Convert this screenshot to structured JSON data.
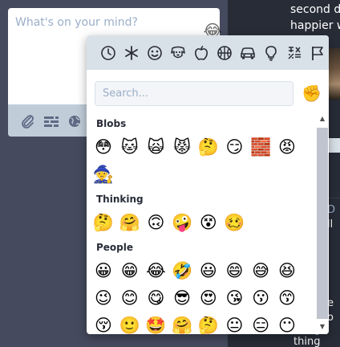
{
  "compose": {
    "placeholder": "What's on your mind?",
    "emoji_trigger": "😂",
    "tools": [
      "paperclip-icon",
      "poll-icon",
      "globe-icon"
    ]
  },
  "background": {
    "toot_text": [
      "second d",
      "happier w"
    ],
    "fragments": [
      "i",
      "t",
      "l",
      "ll",
      "D",
      "e",
      "o",
      "thing"
    ]
  },
  "picker": {
    "categories": [
      {
        "name": "clock-icon",
        "label": "Frequently used"
      },
      {
        "name": "asterisk-icon",
        "label": "Custom"
      },
      {
        "name": "smiley-icon",
        "label": "People"
      },
      {
        "name": "dog-icon",
        "label": "Nature"
      },
      {
        "name": "apple-icon",
        "label": "Food"
      },
      {
        "name": "basketball-icon",
        "label": "Activity"
      },
      {
        "name": "car-icon",
        "label": "Travel"
      },
      {
        "name": "lightbulb-icon",
        "label": "Objects"
      },
      {
        "name": "symbols-icon",
        "label": "Symbols"
      },
      {
        "name": "flag-icon",
        "label": "Flags"
      }
    ],
    "search_placeholder": "Search...",
    "skin_tone_emoji": "✊",
    "sections": [
      {
        "title": "Blobs",
        "emojis": [
          "😳",
          "🐱",
          "🙀",
          "😾",
          "🤔",
          "😏",
          "🧱",
          "😡",
          "🧙"
        ]
      },
      {
        "title": "Thinking",
        "emojis": [
          "🤔",
          "🤗",
          "🙃",
          "🤪",
          "😵",
          "🥴"
        ]
      },
      {
        "title": "People",
        "emojis": [
          "😀",
          "😁",
          "😂",
          "🤣",
          "😃",
          "😄",
          "😅",
          "😆",
          "😉",
          "😊",
          "😋",
          "😎",
          "😍",
          "😘",
          "😗",
          "😙",
          "😚",
          "🙂",
          "🤩",
          "🤗",
          "🤔",
          "😐",
          "😑",
          "😶"
        ]
      }
    ]
  }
}
